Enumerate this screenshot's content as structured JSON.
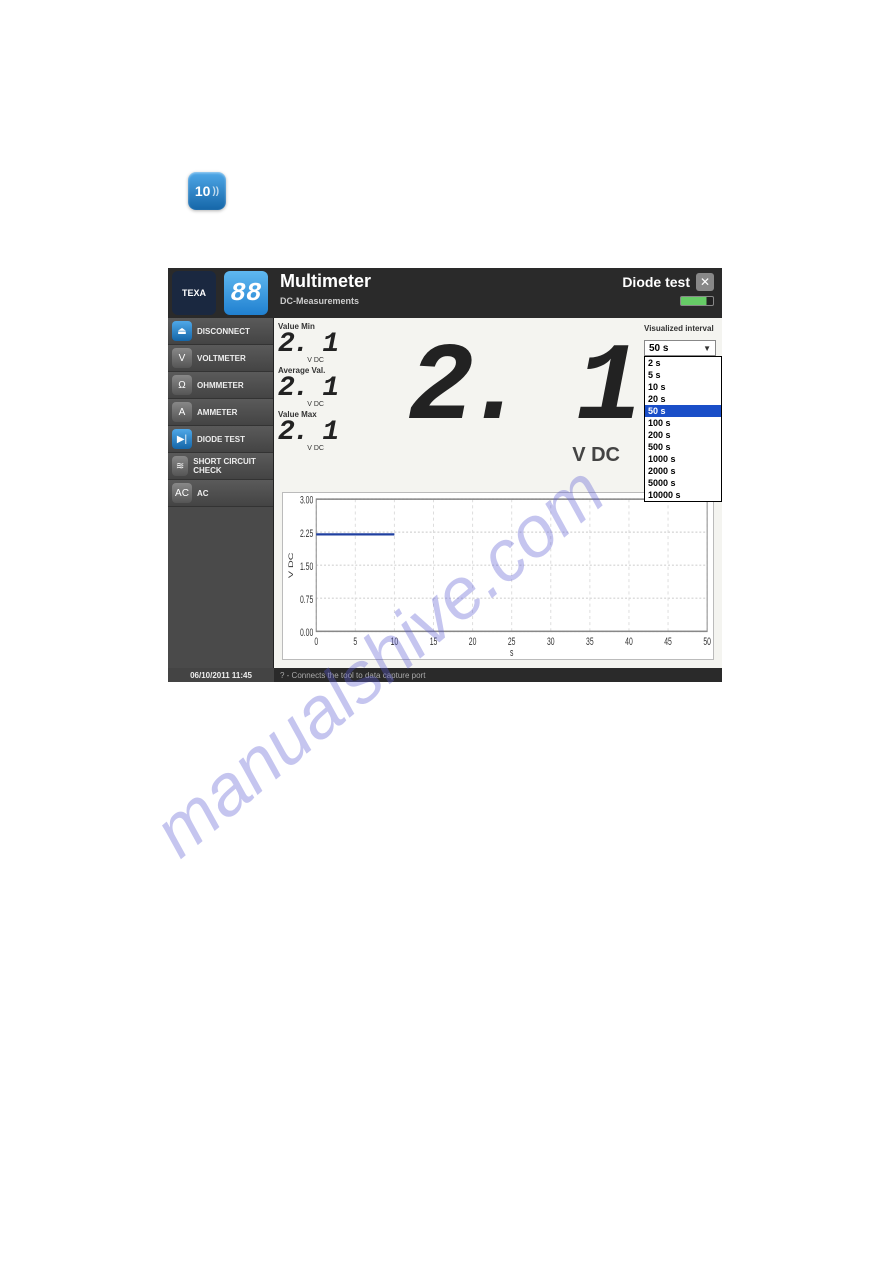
{
  "page_icon": {
    "text": "10"
  },
  "header": {
    "title": "Multimeter",
    "mode": "Diode test",
    "subtitle": "DC-Measurements",
    "logo_text": "TEXA",
    "digit_display": "88"
  },
  "sidebar": {
    "items": [
      {
        "label": "DISCONNECT",
        "icon_name": "disconnect-icon",
        "icon_glyph": "⏏",
        "style": "blue"
      },
      {
        "label": "VOLTMETER",
        "icon_name": "voltmeter-icon",
        "icon_glyph": "V",
        "style": "gray"
      },
      {
        "label": "OHMMETER",
        "icon_name": "ohmmeter-icon",
        "icon_glyph": "Ω",
        "style": "gray"
      },
      {
        "label": "AMMETER",
        "icon_name": "ammeter-icon",
        "icon_glyph": "A",
        "style": "gray"
      },
      {
        "label": "DIODE TEST",
        "icon_name": "diode-icon",
        "icon_glyph": "▶|",
        "style": "blue"
      },
      {
        "label": "SHORT CIRCUIT CHECK",
        "icon_name": "short-circuit-icon",
        "icon_glyph": "≋",
        "style": "gray"
      },
      {
        "label": "AC",
        "icon_name": "ac-icon",
        "icon_glyph": "AC",
        "style": "gray"
      }
    ]
  },
  "readings": {
    "min": {
      "label": "Value Min",
      "value": "2. 1",
      "unit": "V DC"
    },
    "avg": {
      "label": "Average Val.",
      "value": "2. 1",
      "unit": "V DC"
    },
    "max": {
      "label": "Value Max",
      "value": "2. 1",
      "unit": "V DC"
    },
    "big": {
      "value": "2. 1",
      "unit": "V DC"
    }
  },
  "interval": {
    "label": "Visualized interval",
    "selected": "50 s",
    "options": [
      "2 s",
      "5 s",
      "10 s",
      "20 s",
      "50 s",
      "100 s",
      "200 s",
      "500 s",
      "1000 s",
      "2000 s",
      "5000 s",
      "10000 s"
    ]
  },
  "chart_data": {
    "type": "line",
    "x": [
      0,
      2,
      8,
      10
    ],
    "values": [
      2.2,
      2.2,
      2.2,
      2.2
    ],
    "xlabel": "s",
    "ylabel": "V DC",
    "xlim": [
      0,
      50
    ],
    "ylim": [
      0,
      3.0
    ],
    "xticks": [
      0,
      5,
      10,
      15,
      20,
      25,
      30,
      35,
      40,
      45,
      50
    ],
    "yticks": [
      0.0,
      0.75,
      1.5,
      2.25,
      3.0
    ]
  },
  "statusbar": {
    "timestamp": "06/10/2011  11:45",
    "message": "? - Connects the tool to data capture port"
  },
  "watermark": "manualshive.com"
}
